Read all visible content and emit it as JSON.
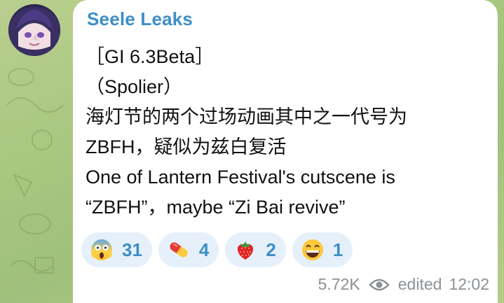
{
  "channel": {
    "name": "Seele Leaks",
    "avatar_alt": "channel-avatar"
  },
  "message": {
    "lines": [
      "［GI 6.3Beta］",
      "（Spolier）",
      "海灯节的两个过场动画其中之一代号为",
      "ZBFH，疑似为兹白复活",
      "One of Lantern Festival's cutscene is",
      "“ZBFH”，maybe “Zi Bai revive”"
    ]
  },
  "reactions": [
    {
      "icon": "scream-emoji-icon",
      "count": "31"
    },
    {
      "icon": "pill-emoji-icon",
      "count": "4"
    },
    {
      "icon": "strawberry-emoji-icon",
      "count": "2"
    },
    {
      "icon": "grin-emoji-icon",
      "count": "1"
    }
  ],
  "meta": {
    "views": "5.72K",
    "edited_label": "edited",
    "time": "12:02"
  },
  "colors": {
    "accent": "#3d8ec6",
    "reaction_bg": "#e6f0fb",
    "meta_text": "#8c9196",
    "wallpaper": "#a8c77f"
  }
}
